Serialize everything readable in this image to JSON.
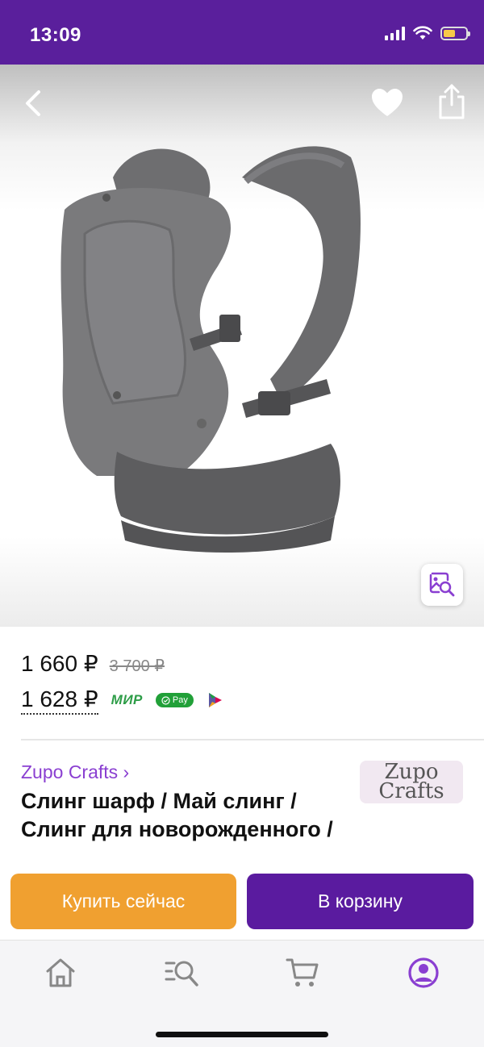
{
  "status_bar": {
    "time": "13:09"
  },
  "product": {
    "price_current": "1 660 ₽",
    "price_old": "3 700 ₽",
    "price_card": "1 628 ₽",
    "payment_methods": {
      "mir": "МИР",
      "spay": "Pay"
    },
    "seller": "Zupo Crafts ›",
    "seller_logo_line1": "Zupo",
    "seller_logo_line2": "Crafts",
    "title": "Слинг шарф / Май слинг / Слинг для новорожденного /"
  },
  "actions": {
    "buy_now": "Купить сейчас",
    "add_to_cart": "В корзину"
  },
  "tab_bar": {
    "items": [
      "home-icon",
      "catalog-search-icon",
      "cart-icon",
      "profile-icon"
    ],
    "active": "profile-icon"
  },
  "colors": {
    "brand_purple": "#5a1f9c",
    "buy_orange": "#f0a030",
    "seller_link": "#8a3fd1",
    "tab_active": "#8a3fd1",
    "tab_inactive": "#888888"
  }
}
